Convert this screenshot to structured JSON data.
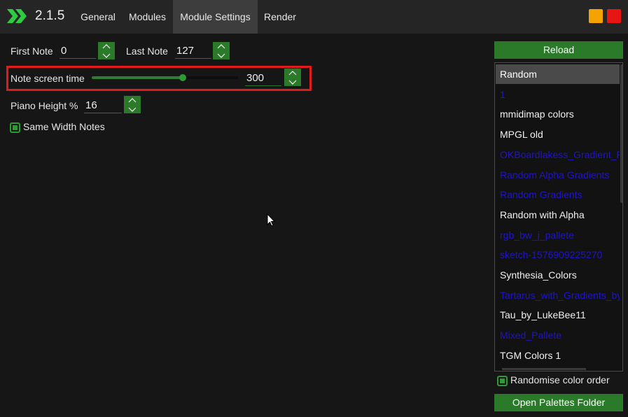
{
  "app": {
    "version": "2.1.5",
    "logo_icon": "double-chevron-right-icon",
    "accent_color": "#2a7a2a"
  },
  "tabs": [
    {
      "label": "General"
    },
    {
      "label": "Modules"
    },
    {
      "label": "Module Settings",
      "active": true
    },
    {
      "label": "Render"
    }
  ],
  "settings": {
    "first_note": {
      "label": "First Note",
      "value": "0"
    },
    "last_note": {
      "label": "Last Note",
      "value": "127"
    },
    "note_screen_time": {
      "label": "Note screen time",
      "value": "300",
      "slider_fraction": 0.62
    },
    "piano_height": {
      "label": "Piano Height %",
      "value": "16"
    },
    "same_width_notes": {
      "label": "Same Width Notes",
      "checked": true
    }
  },
  "palettes": {
    "reload_label": "Reload",
    "items": [
      {
        "name": "Random",
        "selected": true,
        "color": "white"
      },
      {
        "name": "1",
        "color": "blue"
      },
      {
        "name": "mmidimap colors",
        "color": "white"
      },
      {
        "name": "MPGL old",
        "color": "white"
      },
      {
        "name": "OKBoardlakess_Gradient_Pal",
        "color": "blue"
      },
      {
        "name": "Random Alpha Gradients",
        "color": "blue"
      },
      {
        "name": "Random Gradients",
        "color": "blue"
      },
      {
        "name": "Random with Alpha",
        "color": "white"
      },
      {
        "name": "rgb_bw_j_pallete",
        "color": "blue"
      },
      {
        "name": "sketch-1576909225270",
        "color": "blue"
      },
      {
        "name": "Synthesia_Colors",
        "color": "white"
      },
      {
        "name": "Tartarus_with_Gradients_by_L",
        "color": "blue"
      },
      {
        "name": "Tau_by_LukeBee11",
        "color": "white"
      },
      {
        "name": "Mixed_Pallete",
        "color": "blue"
      },
      {
        "name": "TGM Colors 1",
        "color": "white"
      }
    ],
    "randomise_label": "Randomise color order",
    "randomise_checked": true,
    "open_folder_label": "Open Palettes Folder"
  }
}
